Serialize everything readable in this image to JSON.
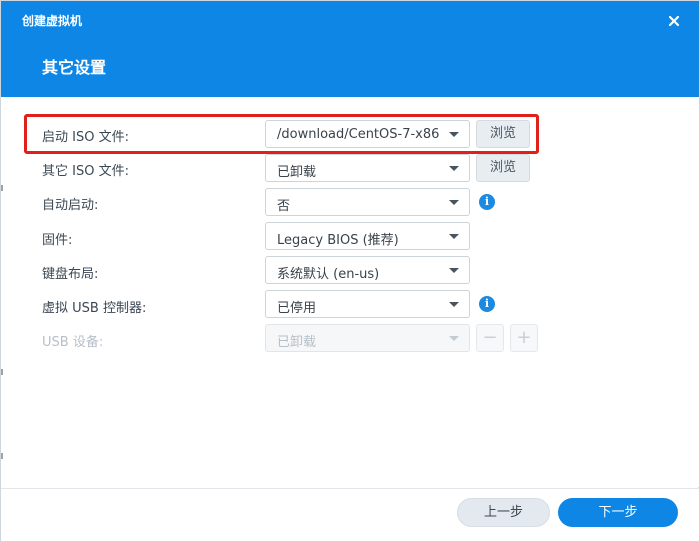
{
  "window": {
    "title": "创建虚拟机",
    "close_icon": "close-icon"
  },
  "page": {
    "title": "其它设置"
  },
  "colors": {
    "header": "#0d86e6",
    "accent": "#0d86e6",
    "highlight": "#e0201a"
  },
  "form": {
    "boot_iso": {
      "label": "启动 ISO 文件:",
      "value": "/download/CentOS-7-x86",
      "browse": "浏览"
    },
    "other_iso": {
      "label": "其它 ISO 文件:",
      "value": "已卸载",
      "browse": "浏览"
    },
    "autostart": {
      "label": "自动启动:",
      "value": "否"
    },
    "firmware": {
      "label": "固件:",
      "value": "Legacy BIOS (推荐)"
    },
    "keyboard": {
      "label": "键盘布局:",
      "value": "系统默认 (en-us)"
    },
    "usb_controller": {
      "label": "虚拟 USB 控制器:",
      "value": "已停用"
    },
    "usb_device": {
      "label": "USB 设备:",
      "value": "已卸载",
      "remove": "−",
      "add": "+"
    }
  },
  "info_glyph": "i",
  "footer": {
    "prev": "上一步",
    "next": "下一步"
  }
}
